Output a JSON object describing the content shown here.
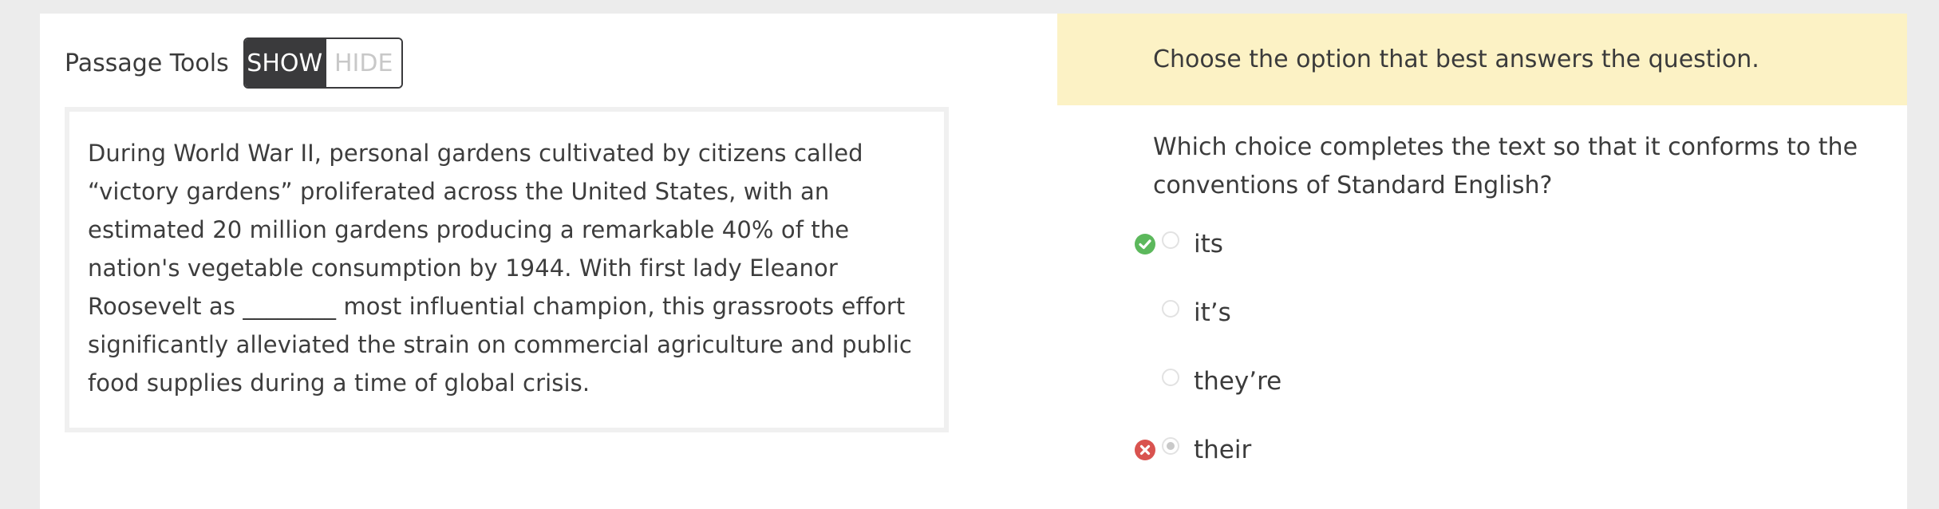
{
  "passage_tools": {
    "label": "Passage Tools",
    "show_label": "SHOW",
    "hide_label": "HIDE",
    "selected": "SHOW"
  },
  "passage": {
    "text": "During World War II, personal gardens cultivated by citizens called “victory gardens” proliferated across the United States, with an estimated 20 million gardens producing a remarkable 40% of the nation's vegetable consumption by 1944. With first lady Eleanor Roosevelt as ________ most influential champion, this grassroots effort significantly alleviated the strain on commercial agriculture and public food supplies during a time of global crisis."
  },
  "instruction": {
    "text": "Choose the option that best answers the question."
  },
  "question": {
    "text": "Which choice completes the text so that it conforms to the conventions of Standard English?"
  },
  "choices": [
    {
      "label": "its",
      "status": "correct",
      "selected": false
    },
    {
      "label": "it’s",
      "status": "none",
      "selected": false
    },
    {
      "label": "they’re",
      "status": "none",
      "selected": false
    },
    {
      "label": "their",
      "status": "incorrect",
      "selected": true
    }
  ],
  "colors": {
    "correct": "#5cb85c",
    "incorrect": "#d9534f",
    "instruction_bg": "#fcf2c5",
    "toggle_dark": "#3a3a3c"
  },
  "icons": {
    "correct": "check-circle-icon",
    "incorrect": "x-circle-icon"
  }
}
